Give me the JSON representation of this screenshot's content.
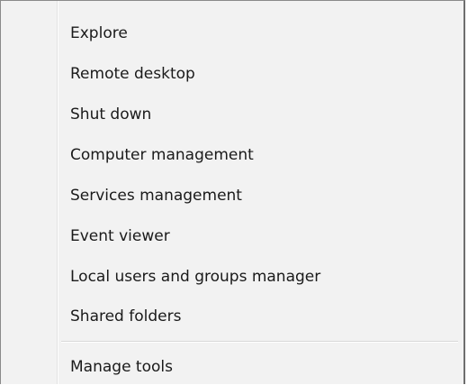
{
  "context_menu": {
    "items": [
      {
        "label": "Explore"
      },
      {
        "label": "Remote desktop"
      },
      {
        "label": "Shut down"
      },
      {
        "label": "Computer management"
      },
      {
        "label": "Services management"
      },
      {
        "label": "Event viewer"
      },
      {
        "label": "Local users and groups manager"
      },
      {
        "label": "Shared folders"
      }
    ],
    "footer_items": [
      {
        "label": "Manage tools"
      }
    ]
  }
}
